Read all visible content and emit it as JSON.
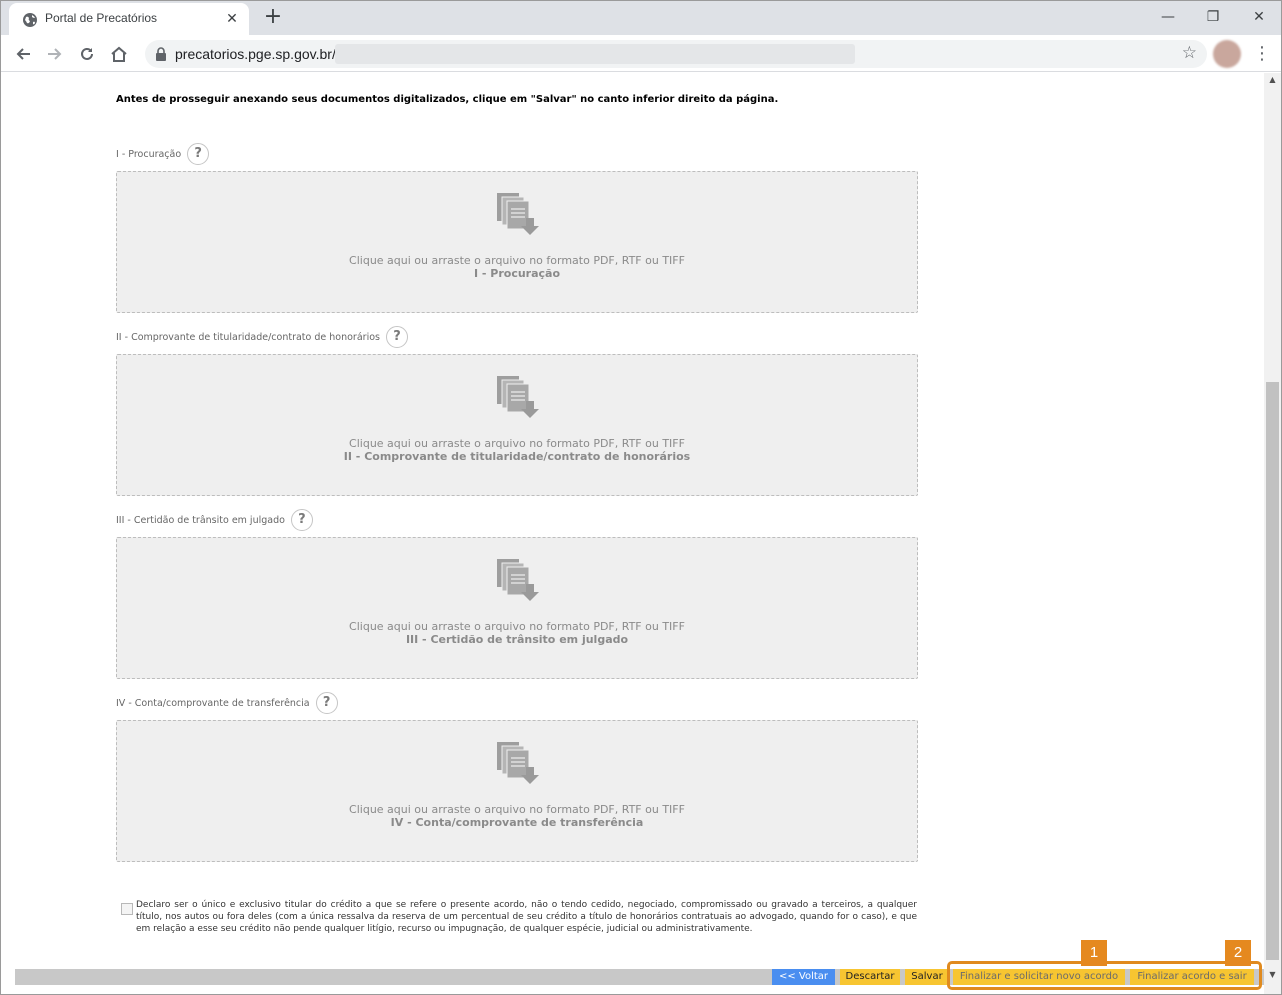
{
  "browser": {
    "tab_title": "Portal de Precatórios",
    "tab_close": "✕",
    "new_tab": "+",
    "url": "precatorios.pge.sp.gov.br/",
    "window_controls": {
      "minimize": "—",
      "restore": "❐",
      "close": "✕"
    },
    "icons": [
      "back-icon",
      "forward-icon",
      "reload-icon",
      "home-icon",
      "lock-icon",
      "star-icon",
      "menu-icon"
    ]
  },
  "page": {
    "notice": "Antes de prosseguir anexando seus documentos digitalizados, clique em \"Salvar\" no canto inferior direito da página.",
    "help_glyph": "?",
    "dropzone_hint": "Clique aqui ou arraste o arquivo no formato PDF, RTF ou TIFF",
    "documents": [
      {
        "label": "I - Procuração",
        "name": "I - Procuração"
      },
      {
        "label": "II - Comprovante de titularidade/contrato de honorários",
        "name": "II - Comprovante de titularidade/contrato de honorários"
      },
      {
        "label": "III - Certidão de trânsito em julgado",
        "name": "III - Certidão de trânsito em julgado"
      },
      {
        "label": "IV - Conta/comprovante de transferência",
        "name": "IV - Conta/comprovante de transferência"
      }
    ],
    "declaration": "Declaro ser o único e exclusivo titular do crédito a que se refere o presente acordo, não o tendo cedido, negociado, compromissado ou gravado a terceiros, a qualquer título, nos autos ou fora deles (com a única ressalva da reserva de um percentual de seu crédito a título de honorários contratuais ao advogado, quando for o caso), e que em relação a esse seu crédito não pende qualquer litígio, recurso ou impugnação, de qualquer espécie, judicial ou administrativamente."
  },
  "actions": {
    "voltar": "<< Voltar",
    "descartar": "Descartar",
    "salvar": "Salvar",
    "finalizar_novo": "Finalizar e solicitar novo acordo",
    "finalizar_sair": "Finalizar acordo e sair"
  },
  "markers": {
    "m1": "1",
    "m2": "2"
  },
  "colors": {
    "highlight": "#e08a1e",
    "button_yellow": "#f7c531",
    "button_blue": "#4a8ef0"
  }
}
